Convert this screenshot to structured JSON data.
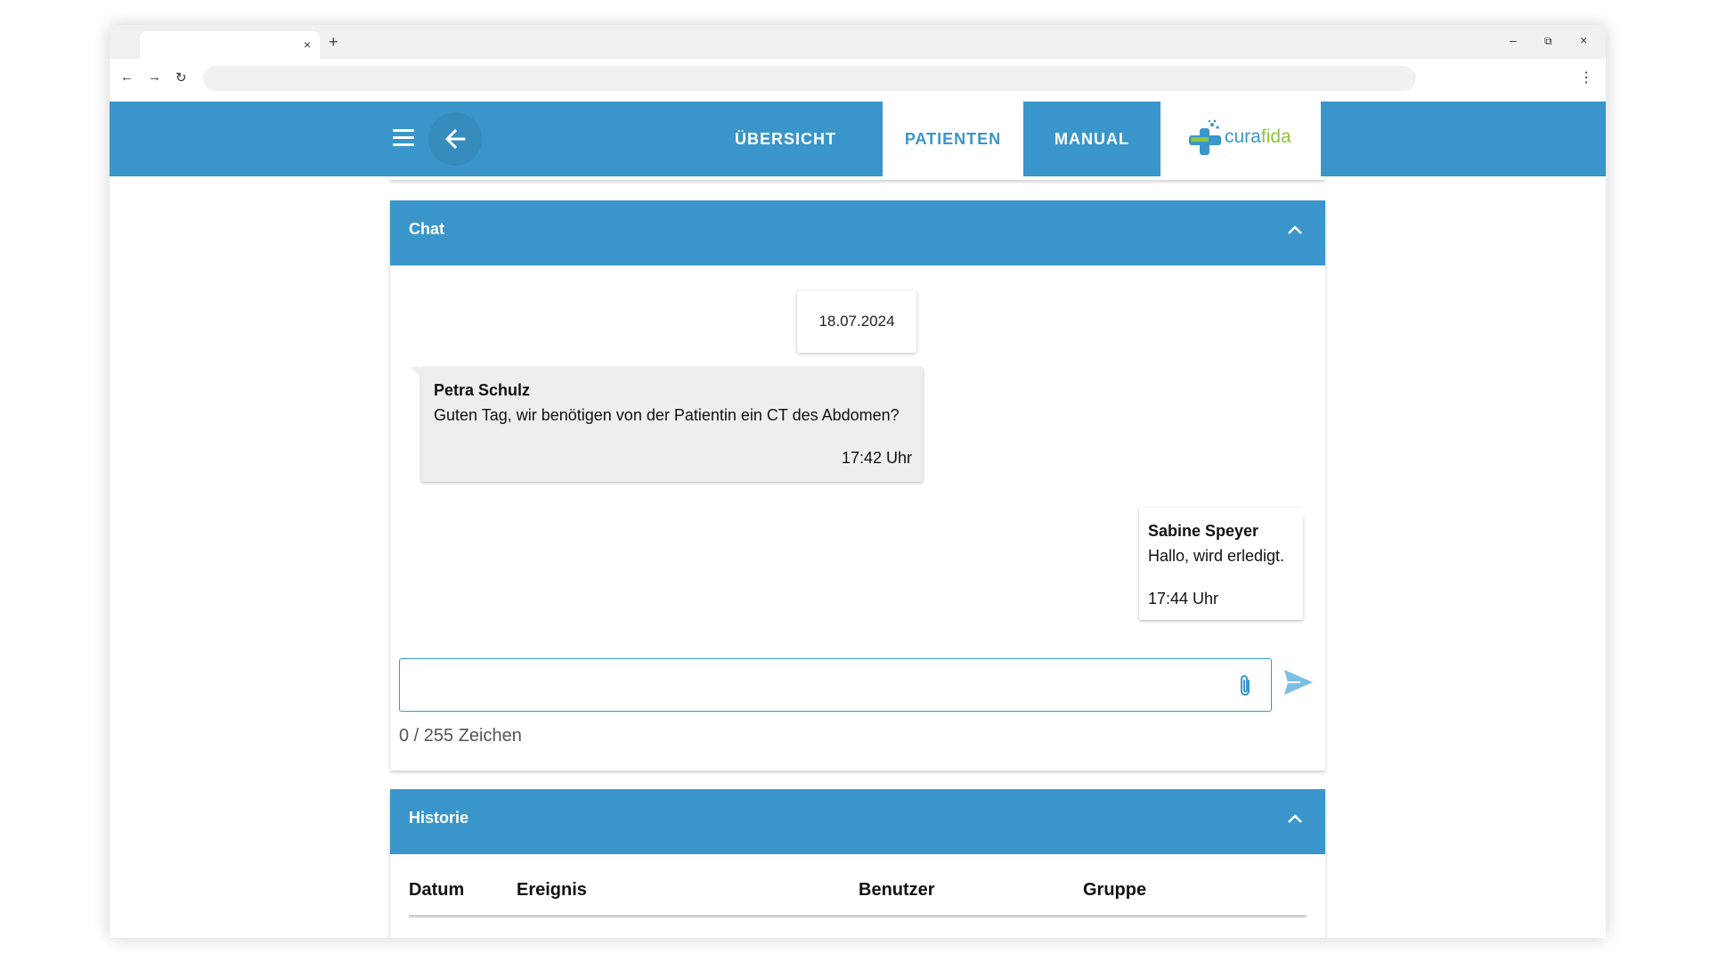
{
  "browser": {
    "tab_close": "×",
    "new_tab": "+",
    "minimize": "–",
    "maximize": "⧉",
    "close": "×",
    "back": "←",
    "forward": "→",
    "reload": "↻",
    "menu": "⋮"
  },
  "appbar": {
    "tabs": [
      {
        "label": "ÜBERSICHT",
        "active": false
      },
      {
        "label": "PATIENTEN",
        "active": true
      },
      {
        "label": "MANUAL",
        "active": false
      }
    ],
    "logo": {
      "part1": "cura",
      "part2": "fida"
    },
    "icons": [
      "hamburger-menu-icon",
      "back-arrow-icon"
    ]
  },
  "chat": {
    "title": "Chat",
    "date": "18.07.2024",
    "messages": [
      {
        "author": "Petra Schulz",
        "text": "Guten Tag, wir benötigen von der Patientin ein CT des Abdomen?",
        "time": "17:42 Uhr",
        "direction": "incoming"
      },
      {
        "author": "Sabine Speyer",
        "text": "Hallo, wird erledigt.",
        "time": "17:44 Uhr",
        "direction": "outgoing"
      }
    ],
    "input": {
      "value": "",
      "placeholder": ""
    },
    "counter": "0 / 255 Zeichen",
    "icons": [
      "paperclip-icon",
      "send-icon",
      "chevron-up-icon"
    ]
  },
  "history": {
    "title": "Historie",
    "columns": [
      "Datum",
      "Ereignis",
      "Benutzer",
      "Gruppe"
    ]
  },
  "colors": {
    "primary": "#3a96ca",
    "logo_accent": "#8cc63f",
    "incoming_bubble": "#eeeeee",
    "send_icon": "#7cbfe3"
  }
}
